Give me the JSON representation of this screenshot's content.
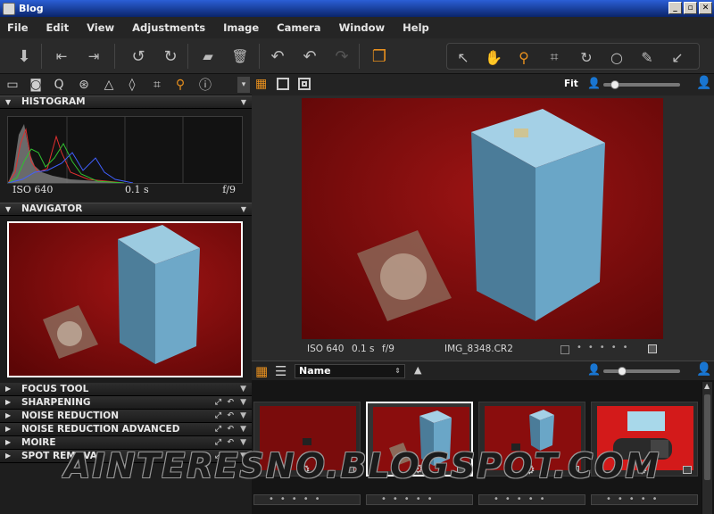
{
  "window": {
    "title": "Blog"
  },
  "menu": [
    "File",
    "Edit",
    "View",
    "Adjustments",
    "Image",
    "Camera",
    "Window",
    "Help"
  ],
  "toolbar": {
    "icons": [
      "import-icon",
      "capture-icon",
      "process-icon",
      "rotate-left-icon",
      "rotate-right-icon",
      "new-folder-icon",
      "trash-icon",
      "undo-all-icon",
      "undo-icon",
      "redo-icon",
      "stack-icon"
    ],
    "cursor_tools": [
      "select-cursor-icon",
      "pan-hand-icon",
      "zoom-icon",
      "crop-icon",
      "rotate-icon",
      "spot-icon",
      "picker-icon",
      "annotate-icon"
    ]
  },
  "tool_tabs": [
    "library-icon",
    "camera-icon",
    "quick-icon",
    "color-icon",
    "exposure-icon",
    "lens-icon",
    "crop-tab-icon",
    "details-icon",
    "metadata-icon"
  ],
  "histogram": {
    "title": "HISTOGRAM",
    "iso": "ISO 640",
    "shutter": "0.1 s",
    "aperture": "f/9"
  },
  "navigator": {
    "title": "NAVIGATOR"
  },
  "tools": [
    {
      "label": "FOCUS TOOL",
      "icons": false
    },
    {
      "label": "SHARPENING",
      "icons": true
    },
    {
      "label": "NOISE REDUCTION",
      "icons": true
    },
    {
      "label": "NOISE REDUCTION ADVANCED",
      "icons": true
    },
    {
      "label": "MOIRE",
      "icons": true
    },
    {
      "label": "SPOT REMOVAL",
      "icons": true
    }
  ],
  "viewer": {
    "fit_label": "Fit",
    "iso": "ISO 640",
    "shutter": "0.1 s",
    "aperture": "f/9",
    "filename": "IMG_8348.CR2"
  },
  "browser": {
    "sort_label": "Name"
  },
  "watermark": "AINTERESNO.BLOGSPOT.COM"
}
